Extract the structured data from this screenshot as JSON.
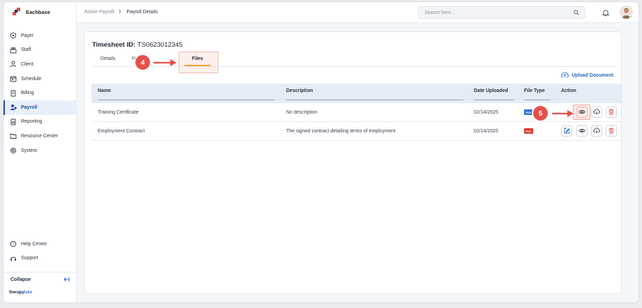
{
  "app": {
    "name": "Eachbase",
    "footer_brand_a": "therapy",
    "footer_brand_b": "lake"
  },
  "sidebar": {
    "items": [
      {
        "label": "Payer",
        "icon": "shield-icon"
      },
      {
        "label": "Staff",
        "icon": "users-icon"
      },
      {
        "label": "Client",
        "icon": "person-icon"
      },
      {
        "label": "Schedule",
        "icon": "calendar-icon"
      },
      {
        "label": "Billing",
        "icon": "document-icon"
      },
      {
        "label": "Payroll",
        "icon": "payroll-icon"
      },
      {
        "label": "Reporting",
        "icon": "report-icon"
      },
      {
        "label": "Resource Center",
        "icon": "folder-icon"
      },
      {
        "label": "System",
        "icon": "settings-icon"
      }
    ],
    "active": "Payroll",
    "bottom": [
      {
        "label": "Help Center",
        "icon": "help-icon"
      },
      {
        "label": "Support",
        "icon": "headset-icon"
      }
    ],
    "collapse_label": "Collapse"
  },
  "topbar": {
    "breadcrumb": [
      "Active Payroll",
      "Payroll Details"
    ],
    "search_placeholder": "Search here..."
  },
  "page": {
    "title_label": "Timesheet ID:",
    "title_value": "TS0623012345",
    "tabs": [
      {
        "label": "Details"
      },
      {
        "label": "N"
      },
      {
        "label": "Files"
      }
    ],
    "active_tab": "Files",
    "upload_label": "Upload Document"
  },
  "table": {
    "columns": [
      "Name",
      "Description",
      "Date Uploaded",
      "File Type",
      "Action"
    ],
    "rows": [
      {
        "name": "Training Certificate",
        "description": "No description",
        "date": "02/14/2025",
        "file_type": "PDF"
      },
      {
        "name": "Employment Contract",
        "description": "The signed contract detailing terms of employment",
        "date": "02/14/2025",
        "file_type": "PDF"
      }
    ]
  },
  "callouts": [
    "4",
    "5"
  ],
  "colors": {
    "accent": "#1b4fa0",
    "callout": "#e4504a",
    "tab_underline": "#f0a33a",
    "pdf_red": "#e23b2e",
    "pdf_blue": "#2f6fd6"
  }
}
